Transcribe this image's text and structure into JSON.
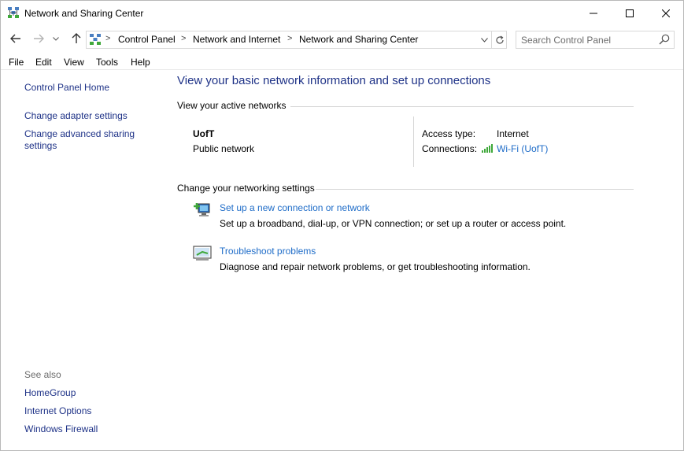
{
  "window": {
    "title": "Network and Sharing Center"
  },
  "address": {
    "crumbs": [
      "Control Panel",
      "Network and Internet",
      "Network and Sharing Center"
    ],
    "separator": ">"
  },
  "search": {
    "placeholder": "Search Control Panel"
  },
  "menu": [
    "File",
    "Edit",
    "View",
    "Tools",
    "Help"
  ],
  "sidebar": {
    "links": [
      "Control Panel Home",
      "Change adapter settings",
      "Change advanced sharing settings"
    ],
    "see_also_label": "See also",
    "see_also": [
      "HomeGroup",
      "Internet Options",
      "Windows Firewall"
    ]
  },
  "main": {
    "heading": "View your basic network information and set up connections",
    "active_networks_title": "View your active networks",
    "network": {
      "name": "UofT",
      "type": "Public network",
      "access_type_label": "Access type:",
      "access_type_value": "Internet",
      "connections_label": "Connections:",
      "connection_link": "Wi-Fi (UofT)"
    },
    "settings_title": "Change your networking settings",
    "tasks": [
      {
        "link": "Set up a new connection or network",
        "description": "Set up a broadband, dial-up, or VPN connection; or set up a router or access point."
      },
      {
        "link": "Troubleshoot problems",
        "description": "Diagnose and repair network problems, or get troubleshooting information."
      }
    ]
  },
  "colors": {
    "link_blue": "#1e6cc8",
    "heading_blue": "#1e3287",
    "muted_gray": "#6d6d6d",
    "wifi_green": "#3fa83a"
  }
}
